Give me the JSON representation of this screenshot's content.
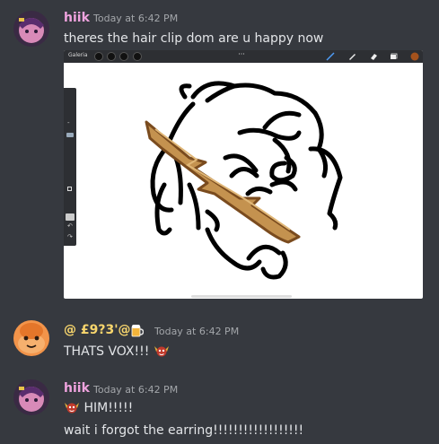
{
  "messages": [
    {
      "username": "hiik",
      "username_color": "#f0a3df",
      "timestamp": "Today at 6:42 PM",
      "lines": [
        "theres the hair clip dom are u happy now"
      ]
    },
    {
      "username": "@ £9?3'@",
      "username_color": "#f8d66d",
      "badge_icon": "beer-mug-icon",
      "timestamp": "Today at 6:42 PM",
      "lines": [
        "THATS VOX!!!"
      ]
    },
    {
      "username": "hiik",
      "username_color": "#f0a3df",
      "timestamp": "Today at 6:42 PM",
      "lines": [
        "HIM!!!!!",
        "wait i forgot the earring!!!!!!!!!!!!!!!!!!"
      ]
    }
  ],
  "attachment": {
    "app_label": "Galeria",
    "toolbar_more": "···"
  }
}
